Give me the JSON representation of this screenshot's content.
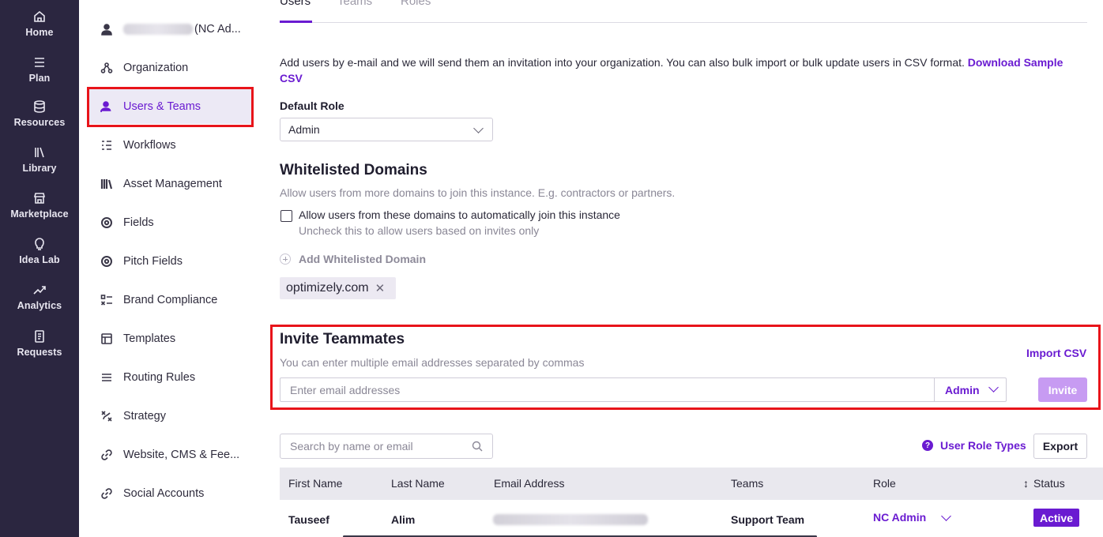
{
  "leftnav": {
    "items": [
      {
        "label": "Home",
        "icon": "home-icon"
      },
      {
        "label": "Plan",
        "icon": "list-icon"
      },
      {
        "label": "Resources",
        "icon": "database-icon"
      },
      {
        "label": "Library",
        "icon": "library-icon"
      },
      {
        "label": "Marketplace",
        "icon": "store-icon"
      },
      {
        "label": "Idea Lab",
        "icon": "lightbulb-icon"
      },
      {
        "label": "Analytics",
        "icon": "trend-icon"
      },
      {
        "label": "Requests",
        "icon": "document-icon"
      }
    ]
  },
  "sidebar": {
    "user_label": "(NC Ad...",
    "items": [
      {
        "label": "Organization",
        "icon": "org-icon"
      },
      {
        "label": "Users & Teams",
        "icon": "user-icon"
      },
      {
        "label": "Workflows",
        "icon": "workflow-icon"
      },
      {
        "label": "Asset Management",
        "icon": "books-icon"
      },
      {
        "label": "Fields",
        "icon": "target-icon"
      },
      {
        "label": "Pitch Fields",
        "icon": "target-icon"
      },
      {
        "label": "Brand Compliance",
        "icon": "checklist-icon"
      },
      {
        "label": "Templates",
        "icon": "template-icon"
      },
      {
        "label": "Routing Rules",
        "icon": "lines-icon"
      },
      {
        "label": "Strategy",
        "icon": "strategy-icon"
      },
      {
        "label": "Website, CMS & Fee...",
        "icon": "link-icon"
      },
      {
        "label": "Social Accounts",
        "icon": "link-icon"
      }
    ]
  },
  "tabs": [
    "Users",
    "Teams",
    "Roles"
  ],
  "intro": {
    "text": "Add users by e-mail and we will send them an invitation into your organization. You can also bulk import or bulk update users in CSV format.",
    "link": "Download Sample CSV"
  },
  "default_role": {
    "label": "Default Role",
    "value": "Admin"
  },
  "whitelist": {
    "title": "Whitelisted Domains",
    "subtitle": "Allow users from more domains to join this instance. E.g. contractors or partners.",
    "checkbox_label": "Allow users from these domains to automatically join this instance",
    "checkbox_hint": "Uncheck this to allow users based on invites only",
    "add_label": "Add Whitelisted Domain",
    "domains": [
      "optimizely.com"
    ]
  },
  "invite": {
    "title": "Invite Teammates",
    "subtitle": "You can enter multiple email addresses separated by commas",
    "import_label": "Import CSV",
    "placeholder": "Enter email addresses",
    "role": "Admin",
    "button": "Invite"
  },
  "users": {
    "search_placeholder": "Search by name or email",
    "role_types_label": "User Role Types",
    "export_label": "Export",
    "columns": [
      "First Name",
      "Last Name",
      "Email Address",
      "Teams",
      "Role",
      "Status"
    ],
    "rows": [
      {
        "first": "Tauseef",
        "last": "Alim",
        "teams": "Support Team",
        "role": "NC Admin",
        "status": "Active"
      }
    ]
  },
  "colors": {
    "accent": "#6a1bd1",
    "nav_bg": "#2b2640",
    "highlight": "#e8141a"
  }
}
